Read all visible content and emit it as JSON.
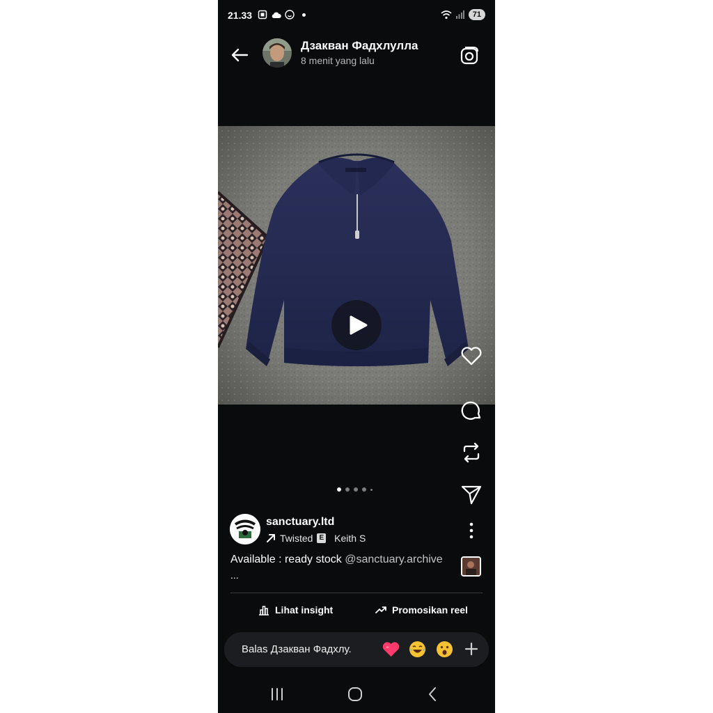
{
  "status_bar": {
    "time": "21.33",
    "battery": "71"
  },
  "header": {
    "user_name": "Дзакван Фадхлулла",
    "time_ago": "8 menit yang lalu"
  },
  "post": {
    "account": "sanctuary.ltd",
    "music_title": "Twisted",
    "explicit_badge": "E",
    "music_artist": "Keith S",
    "caption_text": "Available : ready stock ",
    "caption_mention": "@sanctuary.archive",
    "caption_more": "...",
    "carousel_count": 5,
    "carousel_active": 0
  },
  "actions": {
    "insight_label": "Lihat insight",
    "promote_label": "Promosikan reel"
  },
  "reply": {
    "placeholder": "Balas Дзакван Фадхлу."
  },
  "icons": {
    "back": "arrow-left-icon",
    "camera": "camera-icon",
    "like": "heart-icon",
    "comment": "comment-icon",
    "repost": "repost-icon",
    "share": "send-icon",
    "more": "more-vertical-icon",
    "insight": "bar-chart-icon",
    "promote": "trending-up-icon",
    "play": "play-icon"
  },
  "colors": {
    "background": "#0a0b0d",
    "reply_bar": "#1c1d20",
    "accent_heart": "#ff3b6b"
  }
}
